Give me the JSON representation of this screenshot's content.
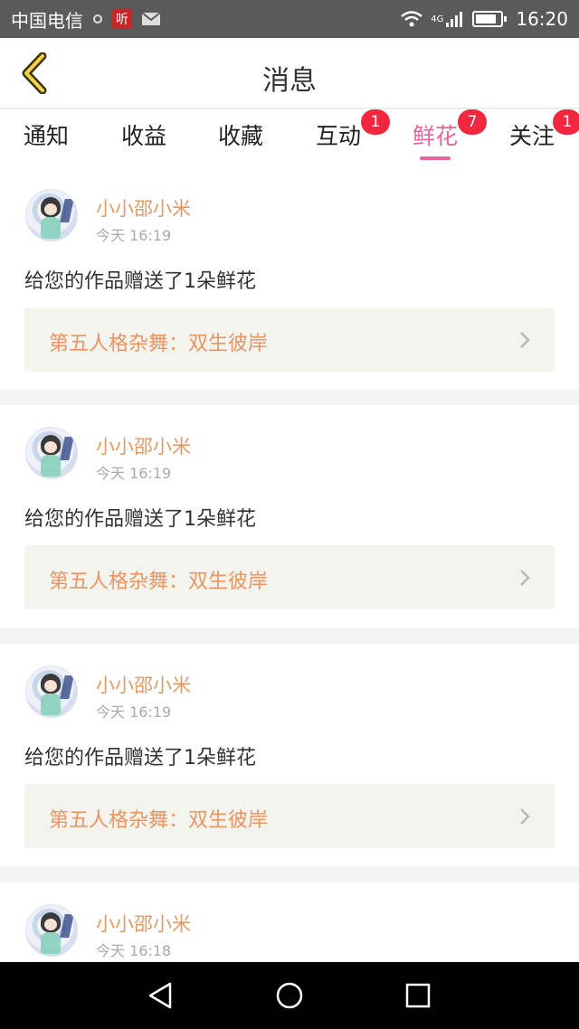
{
  "status_bar": {
    "carrier": "中国电信",
    "ting_label": "听",
    "network": "4G",
    "time": "16:20"
  },
  "header": {
    "title": "消息"
  },
  "tabs": [
    {
      "label": "通知",
      "badge": ""
    },
    {
      "label": "收益",
      "badge": ""
    },
    {
      "label": "收藏",
      "badge": ""
    },
    {
      "label": "互动",
      "badge": "1"
    },
    {
      "label": "鲜花",
      "badge": "7",
      "active": true
    },
    {
      "label": "关注",
      "badge": "1"
    }
  ],
  "messages": [
    {
      "username": "小小邵小米",
      "time": "今天 16:19",
      "text": "给您的作品赠送了1朵鲜花",
      "work_title": "第五人格杂舞：双生彼岸"
    },
    {
      "username": "小小邵小米",
      "time": "今天 16:19",
      "text": "给您的作品赠送了1朵鲜花",
      "work_title": "第五人格杂舞：双生彼岸"
    },
    {
      "username": "小小邵小米",
      "time": "今天 16:19",
      "text": "给您的作品赠送了1朵鲜花",
      "work_title": "第五人格杂舞：双生彼岸"
    },
    {
      "username": "小小邵小米",
      "time": "今天 16:18",
      "text": "",
      "work_title": ""
    }
  ],
  "colors": {
    "accent_pink": "#e8649a",
    "badge_red": "#f0273e",
    "name_orange": "#e89a62",
    "link_orange": "#ee9460"
  }
}
